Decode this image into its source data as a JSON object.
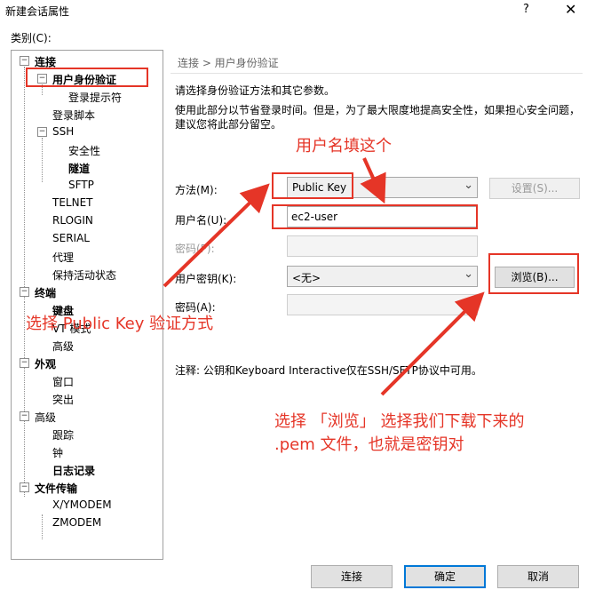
{
  "window": {
    "title": "新建会话属性",
    "help_glyph": "?",
    "close_glyph": "✕"
  },
  "category_label": "类别(C):",
  "tree": [
    {
      "label": "连接",
      "bold": true,
      "toggle": "⊟"
    },
    {
      "label": "用户身份验证",
      "bold": true,
      "toggle": "⊟"
    },
    {
      "label": "登录提示符",
      "bold": false
    },
    {
      "label": "登录脚本",
      "bold": false
    },
    {
      "label": "SSH",
      "bold": false,
      "toggle": "⊟"
    },
    {
      "label": "安全性",
      "bold": false
    },
    {
      "label": "隧道",
      "bold": true
    },
    {
      "label": "SFTP",
      "bold": false
    },
    {
      "label": "TELNET",
      "bold": false
    },
    {
      "label": "RLOGIN",
      "bold": false
    },
    {
      "label": "SERIAL",
      "bold": false
    },
    {
      "label": "代理",
      "bold": false
    },
    {
      "label": "保持活动状态",
      "bold": false
    },
    {
      "label": "终端",
      "bold": true,
      "toggle": "⊟"
    },
    {
      "label": "键盘",
      "bold": true
    },
    {
      "label": "VT 模式",
      "bold": false
    },
    {
      "label": "高级",
      "bold": false
    },
    {
      "label": "外观",
      "bold": true,
      "toggle": "⊟"
    },
    {
      "label": "窗口",
      "bold": false
    },
    {
      "label": "突出",
      "bold": false
    },
    {
      "label": "高级",
      "bold": false,
      "toggle": "⊟"
    },
    {
      "label": "跟踪",
      "bold": false
    },
    {
      "label": "钟",
      "bold": false
    },
    {
      "label": "日志记录",
      "bold": true
    },
    {
      "label": "文件传输",
      "bold": true,
      "toggle": "⊟"
    },
    {
      "label": "X/YMODEM",
      "bold": false
    },
    {
      "label": "ZMODEM",
      "bold": false
    }
  ],
  "breadcrumb": "连接 > 用户身份验证",
  "intro1": "请选择身份验证方法和其它参数。",
  "intro2a": "使用此部分以节省登录时间。但是，为了最大限度地提高安全性，如果担心安全问题，",
  "intro2b": "建议您将此部分留空。",
  "method_label": "方法(M):",
  "method_value": "Public Key",
  "settings_button": "设置(S)...",
  "username_label": "用户名(U):",
  "username_value": "ec2-user",
  "password_label": "密码(P):",
  "userkey_label": "用户密钥(K):",
  "userkey_value": "<无>",
  "browse_button": "浏览(B)...",
  "passphrase_label": "密码(A):",
  "note": "注释: 公钥和Keyboard Interactive仅在SSH/SFTP协议中可用。",
  "buttons": {
    "connect": "连接",
    "ok": "确定",
    "cancel": "取消"
  },
  "annotations": {
    "username_hint": "用户名填这个",
    "method_hint": "选择 Public Key 验证方式",
    "browse_hint_1": "选择 「浏览」 选择我们下载下来的",
    "browse_hint_2": ".pem 文件，也就是密钥对"
  },
  "accent_color": "#e53527"
}
